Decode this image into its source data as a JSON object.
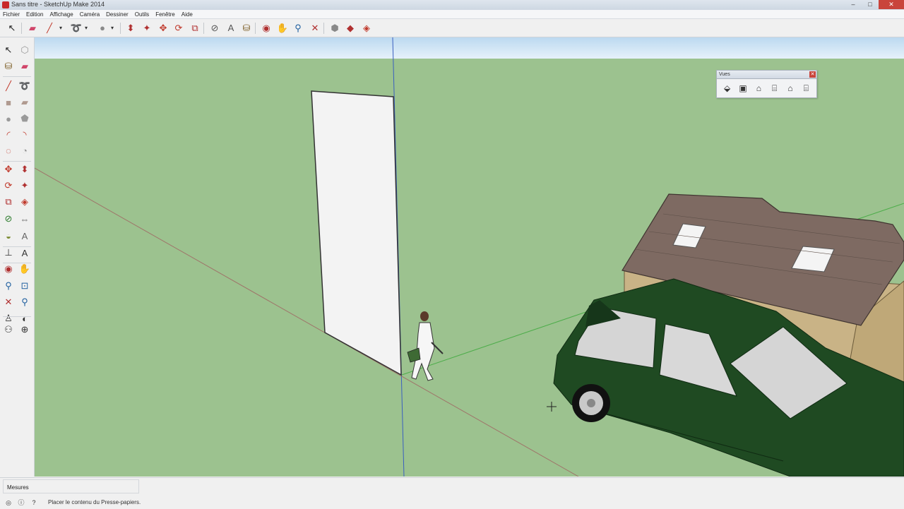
{
  "window": {
    "title": "Sans titre - SketchUp Make 2014",
    "buttons": {
      "minimize": "–",
      "maximize": "□",
      "close": "✕"
    }
  },
  "menu": {
    "items": [
      "Fichier",
      "Edition",
      "Affichage",
      "Caméra",
      "Dessiner",
      "Outils",
      "Fenêtre",
      "Aide"
    ]
  },
  "toolbar": {
    "icons": [
      {
        "name": "select-icon",
        "glyph": "↖",
        "color": "#222222"
      },
      {
        "name": "eraser-icon",
        "glyph": "▰",
        "color": "#d0456a"
      },
      {
        "name": "pencil-icon",
        "glyph": "╱",
        "color": "#c0392b"
      },
      {
        "name": "line-dropdown-icon",
        "glyph": "▾",
        "color": "#333333"
      },
      {
        "name": "freehand-icon",
        "glyph": "➰",
        "color": "#c0392b"
      },
      {
        "name": "shape-dropdown-icon",
        "glyph": "▾",
        "color": "#333333"
      },
      {
        "name": "circle-icon",
        "glyph": "●",
        "color": "#8a8a8a"
      },
      {
        "name": "circle-dropdown-icon",
        "glyph": "▾",
        "color": "#333333"
      },
      {
        "name": "push-pull-icon",
        "glyph": "⬍",
        "color": "#b03030"
      },
      {
        "name": "follow-me-icon",
        "glyph": "✦",
        "color": "#b03030"
      },
      {
        "name": "move-icon",
        "glyph": "✥",
        "color": "#c0392b"
      },
      {
        "name": "rotate-icon",
        "glyph": "⟳",
        "color": "#c0392b"
      },
      {
        "name": "scale-icon",
        "glyph": "⧉",
        "color": "#b03030"
      },
      {
        "name": "tape-measure-icon",
        "glyph": "⊘",
        "color": "#555555"
      },
      {
        "name": "text-icon",
        "glyph": "A",
        "color": "#555555"
      },
      {
        "name": "paint-bucket-icon",
        "glyph": "⛁",
        "color": "#7a5a20"
      },
      {
        "name": "orbit-icon",
        "glyph": "◉",
        "color": "#b03030"
      },
      {
        "name": "pan-icon",
        "glyph": "✋",
        "color": "#c08a30"
      },
      {
        "name": "zoom-icon",
        "glyph": "⚲",
        "color": "#1f5f9f"
      },
      {
        "name": "zoom-extents-icon",
        "glyph": "✕",
        "color": "#b03030"
      },
      {
        "name": "warehouse-icon",
        "glyph": "⬢",
        "color": "#888888"
      },
      {
        "name": "components-icon",
        "glyph": "◆",
        "color": "#b03030"
      },
      {
        "name": "extension-warehouse-icon",
        "glyph": "◈",
        "color": "#c0392b"
      }
    ]
  },
  "left_tools": {
    "icons": [
      {
        "name": "select-tool-icon",
        "glyph": "↖",
        "color": "#222222"
      },
      {
        "name": "make-component-icon",
        "glyph": "⬡",
        "color": "#999999"
      },
      {
        "name": "paint-tool-icon",
        "glyph": "⛁",
        "color": "#7a5a20"
      },
      {
        "name": "eraser-tool-icon",
        "glyph": "▰",
        "color": "#d0456a"
      },
      {
        "name": "line-tool-icon",
        "glyph": "╱",
        "color": "#c0392b"
      },
      {
        "name": "freehand-tool-icon",
        "glyph": "➰",
        "color": "#c0392b"
      },
      {
        "name": "rectangle-tool-icon",
        "glyph": "■",
        "color": "#b09a90"
      },
      {
        "name": "rotated-rectangle-tool-icon",
        "glyph": "▰",
        "color": "#b09a90"
      },
      {
        "name": "circle-tool-icon",
        "glyph": "●",
        "color": "#9a9a9a"
      },
      {
        "name": "polygon-tool-icon",
        "glyph": "⬟",
        "color": "#9a9a9a"
      },
      {
        "name": "arc-tool-icon",
        "glyph": "◜",
        "color": "#c0392b"
      },
      {
        "name": "two-point-arc-icon",
        "glyph": "◝",
        "color": "#c0392b"
      },
      {
        "name": "three-point-arc-icon",
        "glyph": "◌",
        "color": "#c0392b"
      },
      {
        "name": "pie-tool-icon",
        "glyph": "◔",
        "color": "#999999"
      },
      {
        "name": "move-tool-icon",
        "glyph": "✥",
        "color": "#c0392b"
      },
      {
        "name": "push-pull-tool-icon",
        "glyph": "⬍",
        "color": "#b03030"
      },
      {
        "name": "rotate-tool-icon",
        "glyph": "⟳",
        "color": "#c0392b"
      },
      {
        "name": "follow-me-tool-icon",
        "glyph": "✦",
        "color": "#b03030"
      },
      {
        "name": "scale-tool-icon",
        "glyph": "⧉",
        "color": "#b03030"
      },
      {
        "name": "offset-tool-icon",
        "glyph": "◈",
        "color": "#c0392b"
      },
      {
        "name": "tape-measure-tool-icon",
        "glyph": "⊘",
        "color": "#2a7a2a"
      },
      {
        "name": "dimension-tool-icon",
        "glyph": "⇔",
        "color": "#666666"
      },
      {
        "name": "protractor-tool-icon",
        "glyph": "◒",
        "color": "#7a8a30"
      },
      {
        "name": "text-tool-icon",
        "glyph": "A",
        "color": "#666666"
      },
      {
        "name": "axes-tool-icon",
        "glyph": "⊥",
        "color": "#333333"
      },
      {
        "name": "3d-text-tool-icon",
        "glyph": "A",
        "color": "#333333"
      },
      {
        "name": "orbit-tool-icon",
        "glyph": "◉",
        "color": "#b03030"
      },
      {
        "name": "pan-tool-icon",
        "glyph": "✋",
        "color": "#c08a30"
      },
      {
        "name": "zoom-tool-icon",
        "glyph": "⚲",
        "color": "#1f5f9f"
      },
      {
        "name": "zoom-window-tool-icon",
        "glyph": "⊡",
        "color": "#1f5f9f"
      },
      {
        "name": "zoom-extents-tool-icon",
        "glyph": "✕",
        "color": "#b03030"
      },
      {
        "name": "previous-view-tool-icon",
        "glyph": "⚲",
        "color": "#1f5f9f"
      },
      {
        "name": "position-camera-tool-icon",
        "glyph": "♙",
        "color": "#333333"
      },
      {
        "name": "look-around-tool-icon",
        "glyph": "◐",
        "color": "#333333"
      },
      {
        "name": "walk-tool-icon",
        "glyph": "⚇",
        "color": "#333333"
      },
      {
        "name": "section-plane-tool-icon",
        "glyph": "⊕",
        "color": "#333333"
      }
    ]
  },
  "views_panel": {
    "title": "Vues",
    "close": "✕",
    "icons": [
      {
        "name": "iso-view-icon",
        "glyph": "⬙"
      },
      {
        "name": "top-view-icon",
        "glyph": "▣"
      },
      {
        "name": "front-view-icon",
        "glyph": "⌂"
      },
      {
        "name": "right-view-icon",
        "glyph": "⌸"
      },
      {
        "name": "back-view-icon",
        "glyph": "⌂"
      },
      {
        "name": "left-view-icon",
        "glyph": "⌸"
      }
    ]
  },
  "colors": {
    "ground": "#9cc28f",
    "sky_top": "#bcd9f0",
    "sky_bottom": "#e6f1fa",
    "car_body": "#1f4a22",
    "roof": "#7e6a62",
    "wall": "#c9b386",
    "panel": "#f2f2f2"
  },
  "status": {
    "measures_label": "Mesures",
    "message": "Placer le contenu du Presse-papiers.",
    "icons": [
      {
        "name": "geo-location-icon",
        "glyph": "◎"
      },
      {
        "name": "credits-icon",
        "glyph": "ⓘ"
      },
      {
        "name": "help-icon",
        "glyph": "?"
      }
    ]
  }
}
